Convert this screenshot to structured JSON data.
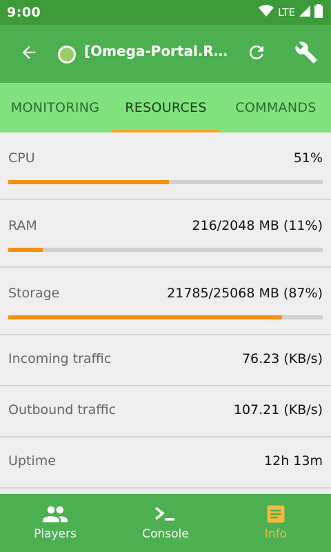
{
  "status_bar": {
    "time": "9:00",
    "network": "LTE",
    "icons": [
      "wifi-icon",
      "signal-icon",
      "battery-icon"
    ]
  },
  "app_bar": {
    "title": "[Omega-Portal.Ru] C...",
    "status_color": "#9ccc65",
    "icons": [
      "back-arrow-icon",
      "refresh-icon",
      "wrench-icon"
    ]
  },
  "tabs": {
    "monitoring": "MONITORING",
    "resources": "RESOURCES",
    "commands": "COMMANDS",
    "active": "RESOURCES"
  },
  "resources": {
    "cpu": {
      "label": "CPU",
      "value": "51%",
      "fraction": 0.51
    },
    "ram": {
      "label": "RAM",
      "value": "216/2048 MB (11%)",
      "fraction": 0.11
    },
    "storage": {
      "label": "Storage",
      "value": "21785/25068 MB (87%)",
      "fraction": 0.87
    },
    "incoming": {
      "label": "Incoming traffic",
      "value": "76.23 (KB/s)"
    },
    "outbound": {
      "label": "Outbound traffic",
      "value": "107.21 (KB/s)"
    },
    "uptime": {
      "label": "Uptime",
      "value": "12h 13m"
    }
  },
  "bottom_nav": {
    "players": "Players",
    "console": "Console",
    "info": "Info",
    "active": "Info",
    "icons": [
      "people-icon",
      "terminal-icon",
      "notes-icon"
    ]
  },
  "colors": {
    "primary": "#4caf50",
    "primary_dark": "#3e9b3a",
    "tab_bar": "#80e27e",
    "accent": "#f6a12b",
    "progress": "#f5900c"
  }
}
